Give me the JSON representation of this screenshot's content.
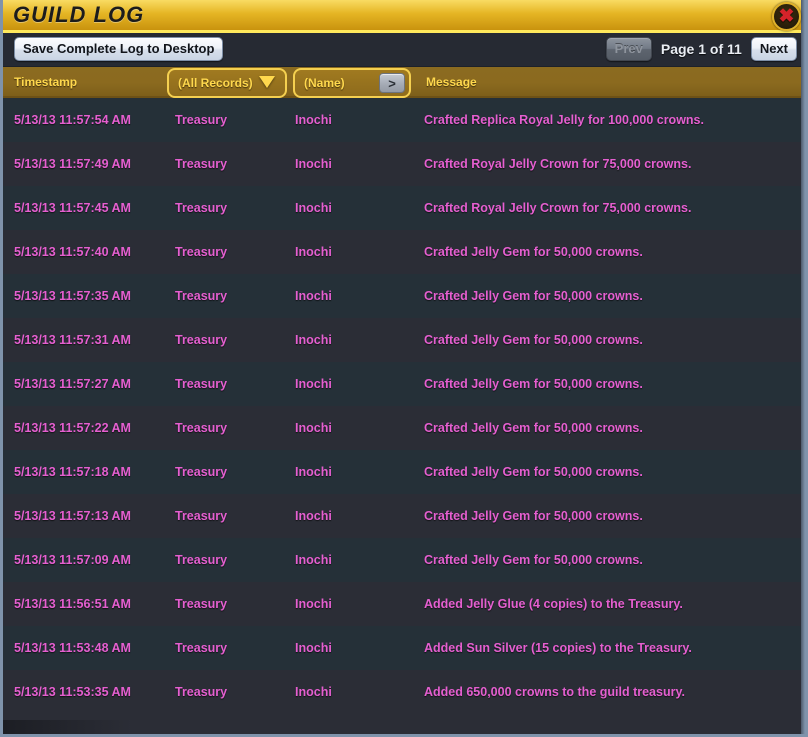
{
  "window": {
    "title": "GUILD LOG",
    "close_icon": "close-icon",
    "accent_gold": "#e5b524",
    "header_gold": "#8b6b20",
    "row_text": "#e55fd0",
    "header_text": "#ffd84d"
  },
  "toolbar": {
    "save_label": "Save Complete Log to Desktop",
    "prev_label": "Prev",
    "page_label": "Page 1 of 11",
    "next_label": "Next"
  },
  "columns": {
    "timestamp": "Timestamp",
    "records_filter": "(All Records)",
    "records_caret_icon": "chevron-down-icon",
    "name_filter": "(Name)",
    "name_go_icon": "chevron-right-icon",
    "message": "Message"
  },
  "rows": [
    {
      "timestamp": "5/13/13 11:57:54 AM",
      "category": "Treasury",
      "name": "Inochi",
      "message": "Crafted Replica Royal Jelly for 100,000 crowns."
    },
    {
      "timestamp": "5/13/13 11:57:49 AM",
      "category": "Treasury",
      "name": "Inochi",
      "message": "Crafted Royal Jelly Crown for 75,000 crowns."
    },
    {
      "timestamp": "5/13/13 11:57:45 AM",
      "category": "Treasury",
      "name": "Inochi",
      "message": "Crafted Royal Jelly Crown for 75,000 crowns."
    },
    {
      "timestamp": "5/13/13 11:57:40 AM",
      "category": "Treasury",
      "name": "Inochi",
      "message": "Crafted Jelly Gem for 50,000 crowns."
    },
    {
      "timestamp": "5/13/13 11:57:35 AM",
      "category": "Treasury",
      "name": "Inochi",
      "message": "Crafted Jelly Gem for 50,000 crowns."
    },
    {
      "timestamp": "5/13/13 11:57:31 AM",
      "category": "Treasury",
      "name": "Inochi",
      "message": "Crafted Jelly Gem for 50,000 crowns."
    },
    {
      "timestamp": "5/13/13 11:57:27 AM",
      "category": "Treasury",
      "name": "Inochi",
      "message": "Crafted Jelly Gem for 50,000 crowns."
    },
    {
      "timestamp": "5/13/13 11:57:22 AM",
      "category": "Treasury",
      "name": "Inochi",
      "message": "Crafted Jelly Gem for 50,000 crowns."
    },
    {
      "timestamp": "5/13/13 11:57:18 AM",
      "category": "Treasury",
      "name": "Inochi",
      "message": "Crafted Jelly Gem for 50,000 crowns."
    },
    {
      "timestamp": "5/13/13 11:57:13 AM",
      "category": "Treasury",
      "name": "Inochi",
      "message": "Crafted Jelly Gem for 50,000 crowns."
    },
    {
      "timestamp": "5/13/13 11:57:09 AM",
      "category": "Treasury",
      "name": "Inochi",
      "message": "Crafted Jelly Gem for 50,000 crowns."
    },
    {
      "timestamp": "5/13/13 11:56:51 AM",
      "category": "Treasury",
      "name": "Inochi",
      "message": "Added Jelly Glue (4 copies) to the Treasury."
    },
    {
      "timestamp": "5/13/13 11:53:48 AM",
      "category": "Treasury",
      "name": "Inochi",
      "message": "Added Sun Silver (15 copies) to the Treasury."
    },
    {
      "timestamp": "5/13/13 11:53:35 AM",
      "category": "Treasury",
      "name": "Inochi",
      "message": "Added 650,000 crowns to the guild treasury."
    }
  ]
}
